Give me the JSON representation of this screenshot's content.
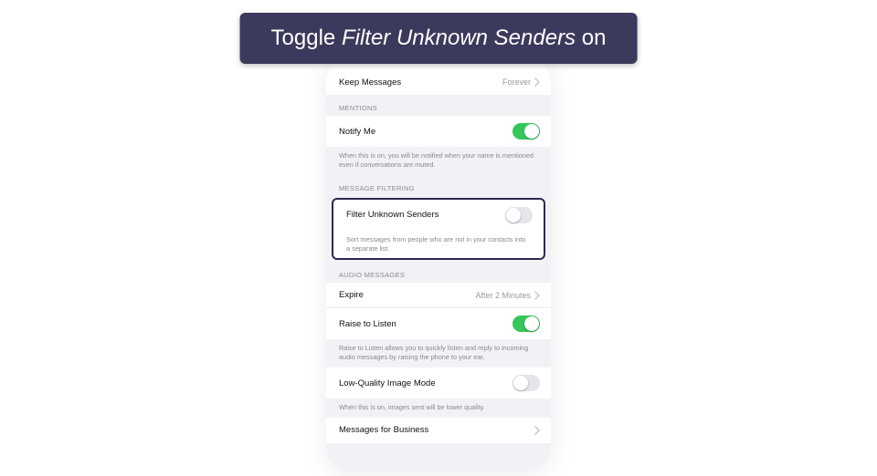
{
  "instruction": {
    "prefix": "Toggle ",
    "emph": "Filter Unknown Senders",
    "suffix": " on"
  },
  "history": {
    "keep_messages_label": "Keep Messages",
    "keep_messages_value": "Forever"
  },
  "mentions": {
    "header": "MENTIONS",
    "notify_me_label": "Notify Me",
    "notify_me_on": true,
    "footer": "When this is on, you will be notified when your name is mentioned even if conversations are muted."
  },
  "filtering": {
    "header": "MESSAGE FILTERING",
    "filter_label": "Filter Unknown Senders",
    "filter_on": false,
    "footer": "Sort messages from people who are not in your contacts into a separate list."
  },
  "audio": {
    "header": "AUDIO MESSAGES",
    "expire_label": "Expire",
    "expire_value": "After 2 Minutes",
    "raise_label": "Raise to Listen",
    "raise_on": true,
    "footer": "Raise to Listen allows you to quickly listen and reply to incoming audio messages by raising the phone to your ear."
  },
  "low_quality": {
    "label": "Low-Quality Image Mode",
    "on": false,
    "footer": "When this is on, images sent will be lower quality."
  },
  "business": {
    "label": "Messages for Business"
  }
}
